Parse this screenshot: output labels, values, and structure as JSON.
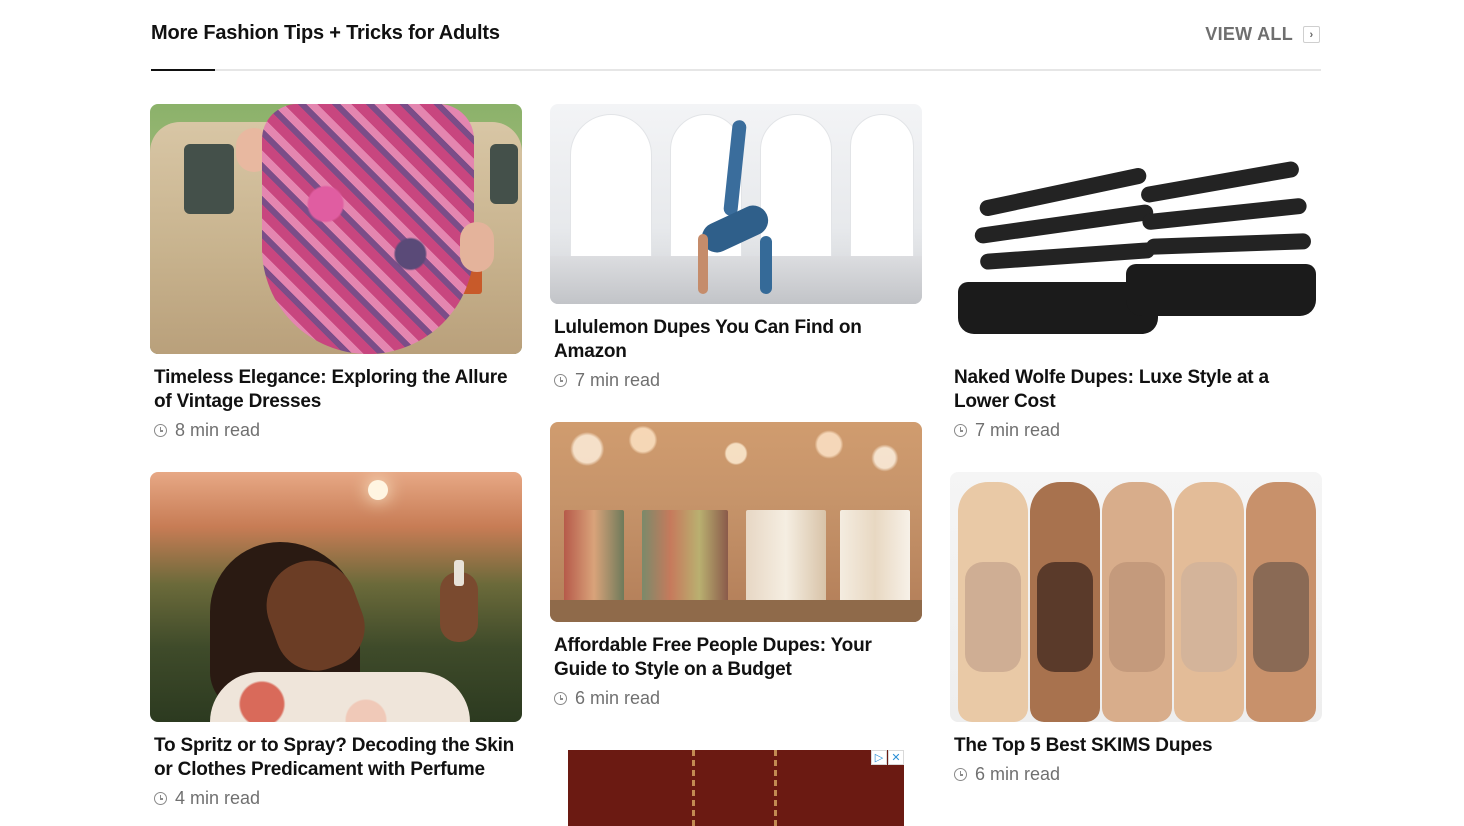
{
  "section": {
    "title": "More Fashion Tips + Tricks for Adults",
    "view_all_label": "VIEW ALL",
    "view_all_icon": "chevron-right-icon"
  },
  "articles": [
    {
      "title": "Timeless Elegance: Exploring the Allure of Vintage Dresses",
      "read_time": "8 min read"
    },
    {
      "title": "Lululemon Dupes You Can Find on Amazon",
      "read_time": "7 min read"
    },
    {
      "title": "Naked Wolfe Dupes: Luxe Style at a Lower Cost",
      "read_time": "7 min read"
    },
    {
      "title": "To Spritz or to Spray? Decoding the Skin or Clothes Predicament with Perfume",
      "read_time": "4 min read"
    },
    {
      "title": "Affordable Free People Dupes: Your Guide to Style on a Budget",
      "read_time": "6 min read"
    },
    {
      "title": "The Top 5 Best SKIMS Dupes",
      "read_time": "6 min read"
    }
  ],
  "ad": {
    "choices_icon": "ad-choices-icon",
    "close_icon": "close-icon",
    "colors": {
      "background": "#6b1a12",
      "accent": "#c28a52"
    }
  },
  "colors": {
    "title": "#111111",
    "muted": "#707070",
    "rule": "#e6e6e6",
    "accent_rule": "#111111"
  }
}
